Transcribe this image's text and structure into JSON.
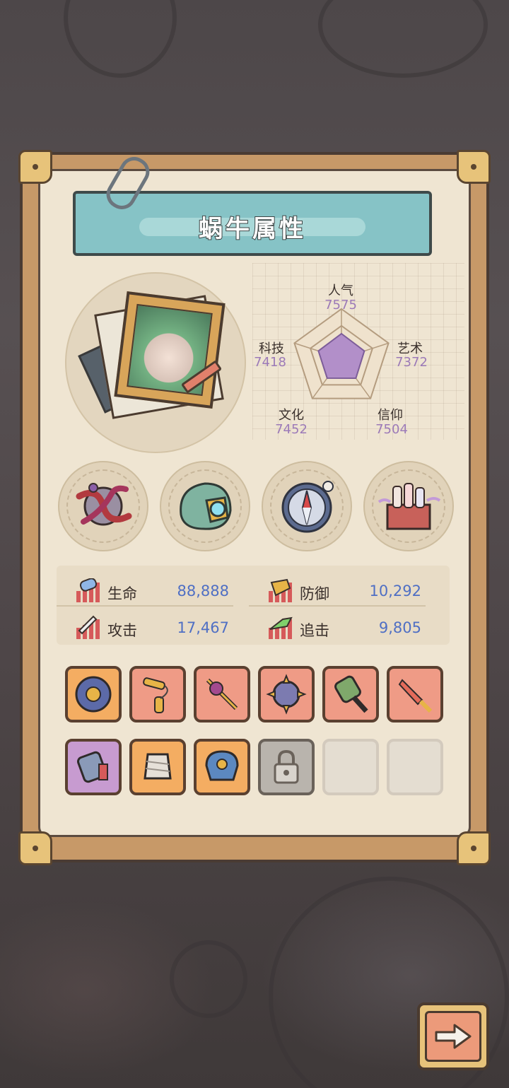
{
  "title": "蜗牛属性",
  "radar": {
    "axes": [
      {
        "label": "人气",
        "value": "7575"
      },
      {
        "label": "艺术",
        "value": "7372"
      },
      {
        "label": "信仰",
        "value": "7504"
      },
      {
        "label": "文化",
        "value": "7452"
      },
      {
        "label": "科技",
        "value": "7418"
      }
    ],
    "fill_color": "#b28fc9"
  },
  "equipment": [
    {
      "icon": "tentacle-orb-icon"
    },
    {
      "icon": "shell-gem-icon"
    },
    {
      "icon": "compass-icon"
    },
    {
      "icon": "potion-crate-icon"
    }
  ],
  "stats": {
    "hp": {
      "label": "生命",
      "value": "88,888",
      "icon": "hp-icon"
    },
    "defense": {
      "label": "防御",
      "value": "10,292",
      "icon": "shield-icon"
    },
    "attack": {
      "label": "攻击",
      "value": "17,467",
      "icon": "attack-icon"
    },
    "pursuit": {
      "label": "追击",
      "value": "9,805",
      "icon": "pursuit-icon"
    }
  },
  "slots": [
    {
      "rarity": "orange",
      "icon": "round-shield-icon"
    },
    {
      "rarity": "red",
      "icon": "nunchaku-icon"
    },
    {
      "rarity": "red",
      "icon": "scepter-icon"
    },
    {
      "rarity": "red",
      "icon": "spiked-orb-icon"
    },
    {
      "rarity": "red",
      "icon": "hammer-icon"
    },
    {
      "rarity": "red",
      "icon": "dagger-icon"
    },
    {
      "rarity": "purple",
      "icon": "gauntlet-icon"
    },
    {
      "rarity": "orange",
      "icon": "bandage-armor-icon"
    },
    {
      "rarity": "orange",
      "icon": "helmet-icon"
    },
    {
      "rarity": "locked",
      "icon": "lock-icon"
    },
    {
      "rarity": "empty",
      "icon": ""
    },
    {
      "rarity": "empty",
      "icon": ""
    }
  ],
  "colors": {
    "stat_value": "#4f6fc4",
    "radar_value": "#9c7ab8",
    "banner": "#86c3c6"
  }
}
